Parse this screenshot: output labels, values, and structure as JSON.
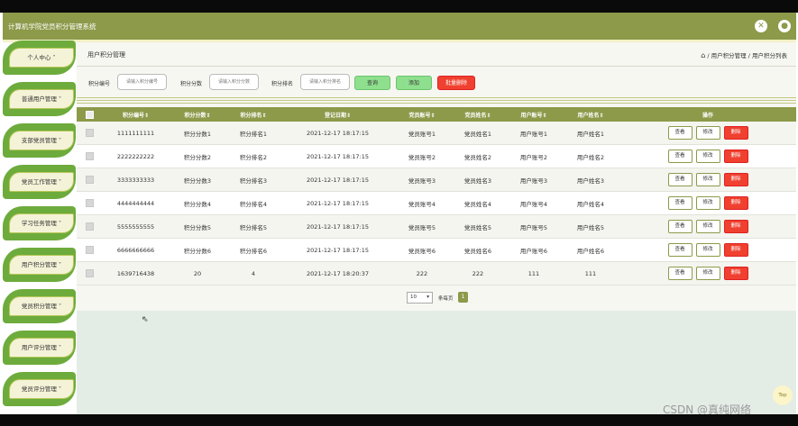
{
  "app": {
    "title": "计算机学院党员积分管理系统",
    "header_icons": [
      "fullscreen-icon",
      "user-icon"
    ]
  },
  "sidebar": {
    "items": [
      {
        "label": "个人中心"
      },
      {
        "label": "普通用户管理"
      },
      {
        "label": "支部党员管理"
      },
      {
        "label": "党员工作管理"
      },
      {
        "label": "学习任务管理"
      },
      {
        "label": "用户积分管理"
      },
      {
        "label": "党员积分管理"
      },
      {
        "label": "用户评分管理"
      },
      {
        "label": "党员评分管理"
      }
    ]
  },
  "page": {
    "title": "用户积分管理",
    "breadcrumb": "/ 用户积分管理 / 用户积分列表"
  },
  "search": {
    "label1": "积分编号",
    "ph1": "请输入积分编号",
    "label2": "积分分数",
    "ph2": "请输入积分分数",
    "label3": "积分排名",
    "ph3": "请输入积分排名",
    "btn_search": "查询",
    "btn_add": "添加",
    "btn_bulk_delete": "批量删除"
  },
  "table": {
    "columns": [
      "积分编号",
      "积分分数",
      "积分排名",
      "登记日期",
      "党员账号",
      "党员姓名",
      "用户账号",
      "用户姓名",
      "操作"
    ],
    "ops": {
      "view": "查看",
      "edit": "修改",
      "delete": "删除"
    },
    "rows": [
      [
        "1111111111",
        "积分分数1",
        "积分排名1",
        "2021-12-17 18:17:15",
        "党员账号1",
        "党员姓名1",
        "用户账号1",
        "用户姓名1"
      ],
      [
        "2222222222",
        "积分分数2",
        "积分排名2",
        "2021-12-17 18:17:15",
        "党员账号2",
        "党员姓名2",
        "用户账号2",
        "用户姓名2"
      ],
      [
        "3333333333",
        "积分分数3",
        "积分排名3",
        "2021-12-17 18:17:15",
        "党员账号3",
        "党员姓名3",
        "用户账号3",
        "用户姓名3"
      ],
      [
        "4444444444",
        "积分分数4",
        "积分排名4",
        "2021-12-17 18:17:15",
        "党员账号4",
        "党员姓名4",
        "用户账号4",
        "用户姓名4"
      ],
      [
        "5555555555",
        "积分分数5",
        "积分排名5",
        "2021-12-17 18:17:15",
        "党员账号5",
        "党员姓名5",
        "用户账号5",
        "用户姓名5"
      ],
      [
        "6666666666",
        "积分分数6",
        "积分排名6",
        "2021-12-17 18:17:15",
        "党员账号6",
        "党员姓名6",
        "用户账号6",
        "用户姓名6"
      ],
      [
        "1639716438",
        "20",
        "4",
        "2021-12-17 18:20:37",
        "222",
        "222",
        "111",
        "111"
      ]
    ]
  },
  "pagination": {
    "page_size": "10",
    "per_page_label": "条每页",
    "current_page": "1"
  },
  "top_button": "Top",
  "watermark": "CSDN @真纯网络",
  "colors": {
    "primary": "#8c9a4a",
    "sidebar_green": "#6dab3c",
    "search_button": "#8ee08e",
    "delete_button": "#f0402f"
  }
}
